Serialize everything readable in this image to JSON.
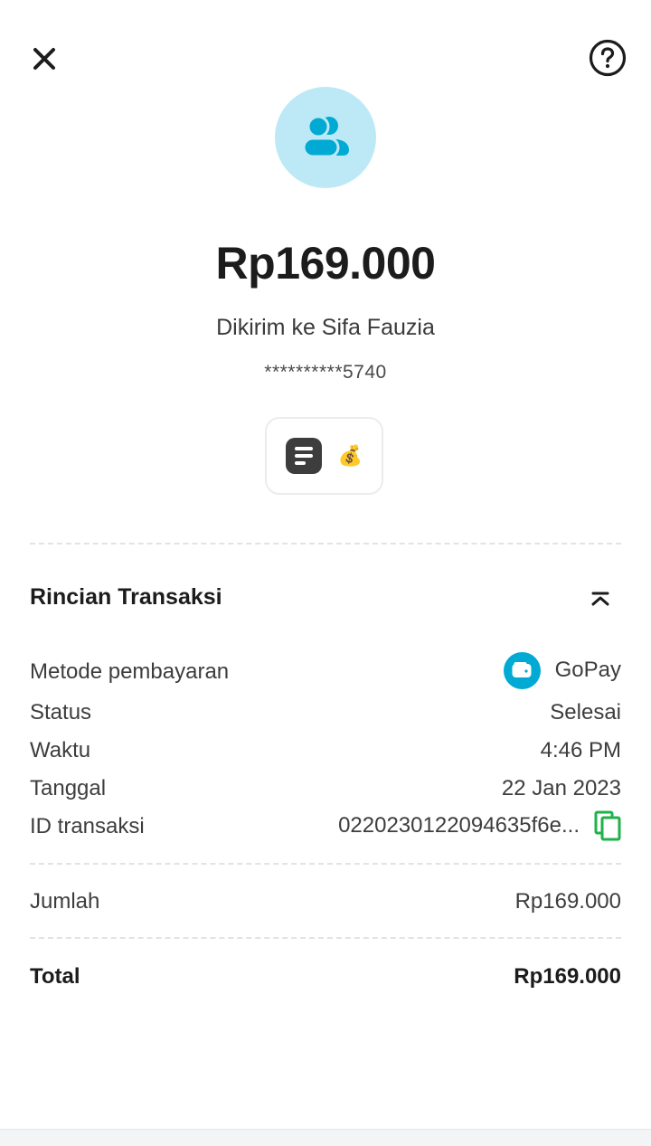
{
  "header": {
    "close_icon": "close-icon",
    "help_icon": "help-circle-icon"
  },
  "hero": {
    "avatar_icon": "users-icon",
    "avatar_bg": "#bde9f6",
    "avatar_fg": "#00aad2",
    "amount": "Rp169.000",
    "recipient": "Dikirim ke Sifa Fauzia",
    "account": "**********5740"
  },
  "actions": {
    "note_icon": "note-icon",
    "moneybag_emoji": "💰"
  },
  "details": {
    "title": "Rincian Transaksi",
    "collapse_icon": "chevron-up-double-icon",
    "rows": {
      "payment_method": {
        "label": "Metode pembayaran",
        "value": "GoPay",
        "icon": "gopay-wallet-icon"
      },
      "status": {
        "label": "Status",
        "value": "Selesai"
      },
      "time": {
        "label": "Waktu",
        "value": "4:46 PM"
      },
      "date": {
        "label": "Tanggal",
        "value": "22 Jan 2023"
      },
      "transaction_id": {
        "label": "ID transaksi",
        "value": "0220230122094635f6e...",
        "icon": "copy-icon"
      }
    },
    "amount_row": {
      "label": "Jumlah",
      "value": "Rp169.000"
    },
    "total_row": {
      "label": "Total",
      "value": "Rp169.000"
    }
  },
  "colors": {
    "accent_blue": "#00aad2",
    "copy_green": "#1fb24a",
    "text_primary": "#1c1c1c",
    "text_secondary": "#3d3d3d"
  }
}
